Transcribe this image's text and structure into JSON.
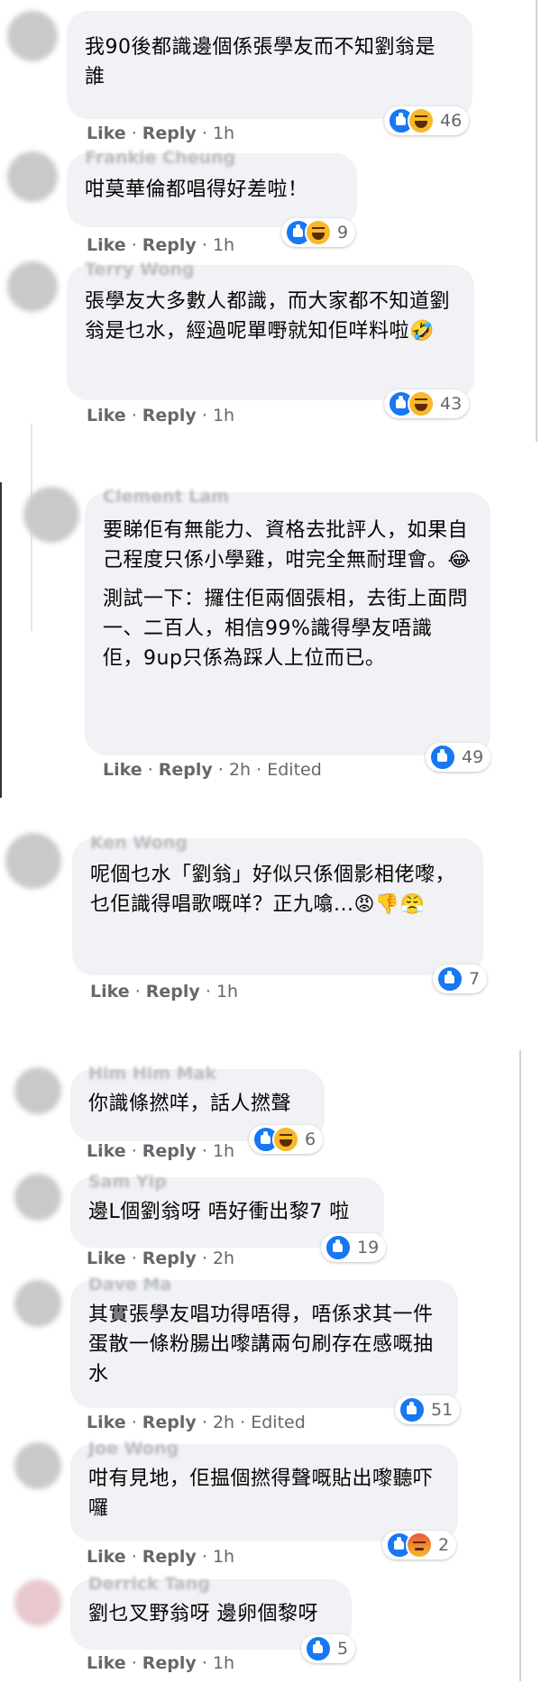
{
  "action_labels": {
    "like": "Like",
    "reply": "Reply",
    "sep": "·",
    "edited": "Edited"
  },
  "comments": [
    {
      "name": "",
      "text": [
        "我90後都識邊個係張學友而不知劉翁是誰"
      ],
      "time": "1h",
      "reactions": [
        "like-icon",
        "haha-icon"
      ],
      "count": "46"
    },
    {
      "name": "Frankie Cheung",
      "text": [
        "咁莫華倫都唱得好差啦！"
      ],
      "time": "1h",
      "reactions": [
        "like-icon",
        "haha-icon"
      ],
      "count": "9"
    },
    {
      "name": "Terry Wong",
      "text": [
        "張學友大多數人都識，而大家都不知道劉翁是乜水，經過呢單嘢就知佢咩料啦🤣"
      ],
      "time": "1h",
      "reactions": [
        "like-icon",
        "haha-icon"
      ],
      "count": "43"
    },
    {
      "name": "Clement Lam",
      "text": [
        "要睇佢有無能力、資格去批評人，如果自己程度只係小學雞，咁完全無耐理會。😂",
        "測試一下：攞住佢兩個張相，去街上面問一、二百人，相信99%識得學友唔識佢，9up只係為踩人上位而已。"
      ],
      "time": "2h",
      "edited": true,
      "reactions": [
        "like-icon"
      ],
      "count": "49"
    },
    {
      "name": "Ken Wong",
      "text": [
        "呢個乜水「劉翁」好似只係個影相佬嚟，乜佢識得唱歌嘅咩？正九噏...😡👎😤"
      ],
      "time": "1h",
      "reactions": [
        "like-icon"
      ],
      "count": "7"
    },
    {
      "name": "Him Him Mak",
      "text": [
        "你識條撚咩，話人撚聲"
      ],
      "time": "1h",
      "reactions": [
        "like-icon",
        "haha-icon"
      ],
      "count": "6"
    },
    {
      "name": "Sam Yip",
      "text": [
        "邊L個劉翁呀 唔好衝出黎7 啦"
      ],
      "time": "2h",
      "reactions": [
        "like-icon"
      ],
      "count": "19"
    },
    {
      "name": "Dave Ma",
      "text": [
        "其實張學友唱功得唔得，唔係求其一件蛋散一條粉腸出嚟講兩句刷存在感嘅抽水"
      ],
      "time": "2h",
      "edited": true,
      "reactions": [
        "like-icon"
      ],
      "count": "51"
    },
    {
      "name": "Joe Wong",
      "text": [
        "咁有見地，佢揾個撚得聲嘅貼出嚟聽吓囉"
      ],
      "time": "1h",
      "reactions": [
        "like-icon",
        "angry-icon"
      ],
      "count": "2"
    },
    {
      "name": "Derrick Tang",
      "text": [
        "劉乜叉野翁呀 邊卵個黎呀"
      ],
      "time": "1h",
      "reactions": [
        "like-icon"
      ],
      "count": "5"
    }
  ]
}
